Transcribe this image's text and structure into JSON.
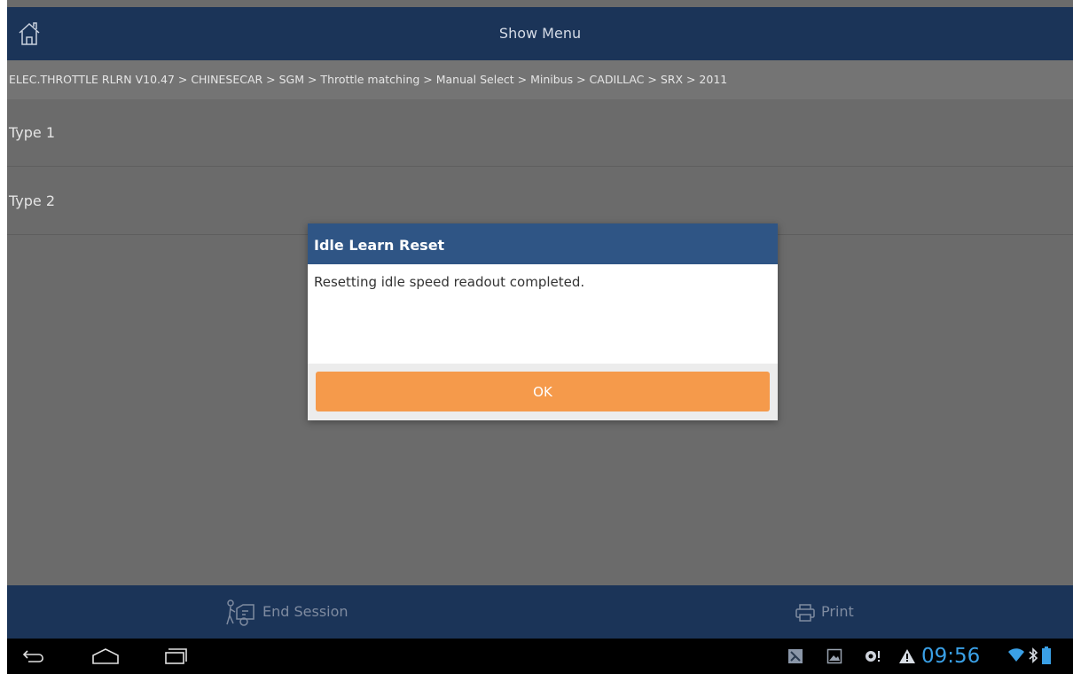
{
  "header": {
    "title": "Show Menu",
    "home_icon": "home-icon"
  },
  "breadcrumb": "ELEC.THROTTLE RLRN V10.47 > CHINESECAR > SGM > Throttle matching > Manual Select > Minibus > CADILLAC > SRX > 2011",
  "list": {
    "items": [
      "Type 1",
      "Type 2"
    ]
  },
  "dialog": {
    "title": "Idle Learn Reset",
    "message": "Resetting idle speed readout completed.",
    "ok_label": "OK"
  },
  "toolbar": {
    "end_session_label": "End Session",
    "print_label": "Print"
  },
  "statusbar": {
    "time": "09:56"
  },
  "colors": {
    "header_bg": "#1b3458",
    "dialog_header_bg": "#2f5585",
    "ok_button_bg": "#f59a4b",
    "clock": "#3aa0e6",
    "background": "#6b6b6b"
  }
}
